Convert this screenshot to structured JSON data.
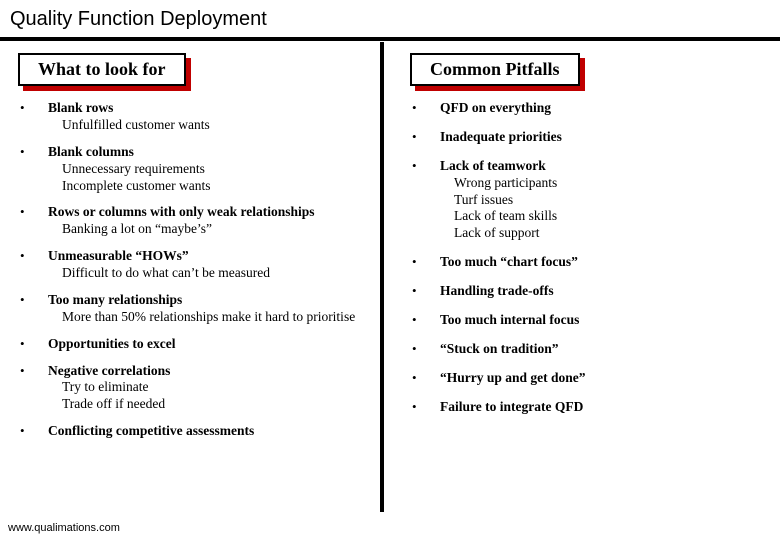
{
  "title": "Quality Function Deployment",
  "left_heading": "What to look for",
  "right_heading": "Common Pitfalls",
  "left_items": [
    {
      "title": "Blank rows",
      "sub": [
        "Unfulfilled customer wants"
      ]
    },
    {
      "title": "Blank columns",
      "sub": [
        "Unnecessary requirements",
        "Incomplete customer wants"
      ]
    },
    {
      "title": "Rows or columns with only weak relationships",
      "sub": [
        "Banking a lot on “maybe’s”"
      ]
    },
    {
      "title": "Unmeasurable “HOWs”",
      "sub": [
        "Difficult to do what can’t be measured"
      ]
    },
    {
      "title": "Too many relationships",
      "sub": [
        "More than 50% relationships make it hard to prioritise"
      ]
    },
    {
      "title": "Opportunities to excel",
      "sub": []
    },
    {
      "title": "Negative correlations",
      "sub": [
        "Try to eliminate",
        "Trade off if needed"
      ]
    },
    {
      "title": "Conflicting competitive assessments",
      "sub": []
    }
  ],
  "right_items": [
    {
      "title": "QFD on everything",
      "sub": []
    },
    {
      "title": "Inadequate priorities",
      "sub": []
    },
    {
      "title": "Lack of teamwork",
      "sub": [
        "Wrong participants",
        "Turf issues",
        "Lack of team skills",
        "Lack of support"
      ]
    },
    {
      "title": "Too much “chart focus”",
      "sub": []
    },
    {
      "title": "Handling trade-offs",
      "sub": []
    },
    {
      "title": "Too much internal focus",
      "sub": []
    },
    {
      "title": "“Stuck on tradition”",
      "sub": []
    },
    {
      "title": "“Hurry up and get done”",
      "sub": []
    },
    {
      "title": "Failure to integrate QFD",
      "sub": []
    }
  ],
  "footer": "www.qualimations.com"
}
